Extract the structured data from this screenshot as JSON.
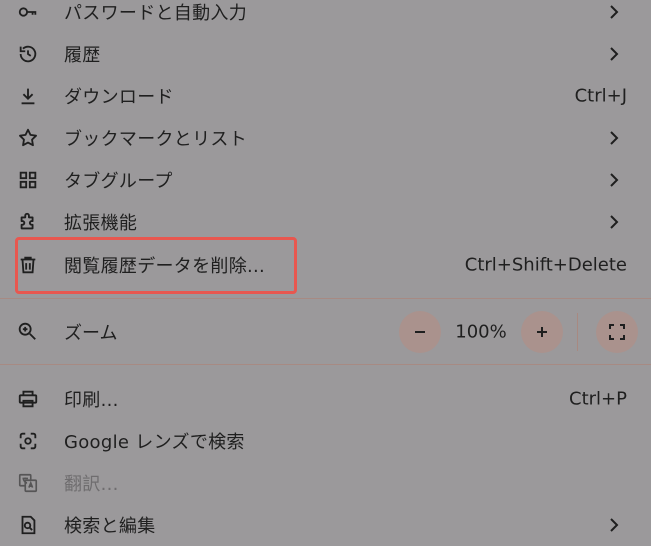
{
  "menu": {
    "items": [
      {
        "label": "パスワードと自動入力",
        "icon": "key-icon",
        "submenu": true
      },
      {
        "label": "履歴",
        "icon": "history-icon",
        "submenu": true
      },
      {
        "label": "ダウンロード",
        "icon": "download-icon",
        "shortcut": "Ctrl+J"
      },
      {
        "label": "ブックマークとリスト",
        "icon": "star-icon",
        "submenu": true
      },
      {
        "label": "タブグループ",
        "icon": "grid-icon",
        "submenu": true
      },
      {
        "label": "拡張機能",
        "icon": "puzzle-icon",
        "submenu": true
      },
      {
        "label": "閲覧履歴データを削除...",
        "icon": "trash-icon",
        "shortcut": "Ctrl+Shift+Delete"
      }
    ],
    "zoom": {
      "label": "ズーム",
      "value": "100%",
      "icon": "zoom-icon"
    },
    "lower_items": [
      {
        "label": "印刷...",
        "icon": "printer-icon",
        "shortcut": "Ctrl+P"
      },
      {
        "label": "Google レンズで検索",
        "icon": "lens-icon"
      },
      {
        "label": "翻訳...",
        "icon": "translate-icon",
        "disabled": true
      },
      {
        "label": "検索と編集",
        "icon": "find-icon",
        "submenu": true
      }
    ]
  },
  "colors": {
    "background": "#9b999b",
    "highlight_border": "#e8574f",
    "button_bg": "#aa928d",
    "text": "#1f1f1f"
  }
}
